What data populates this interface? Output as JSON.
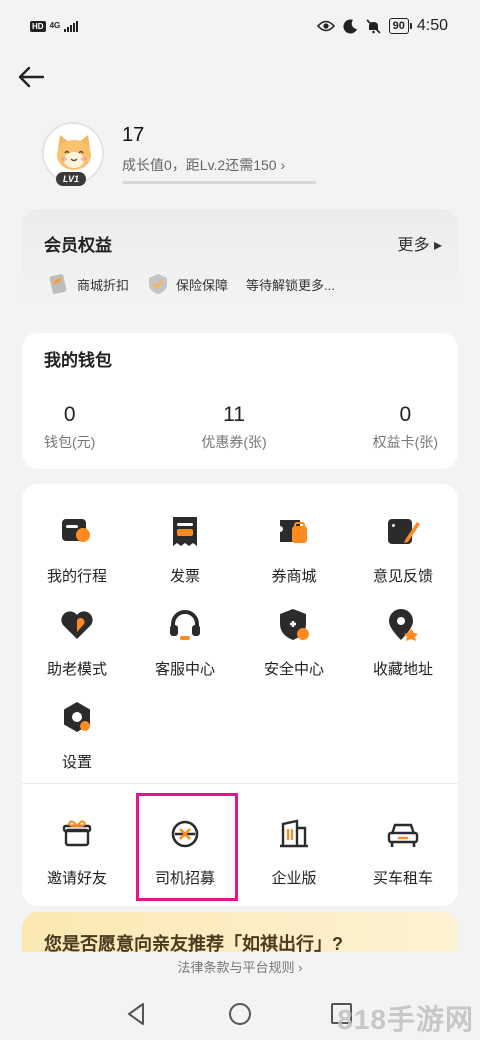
{
  "status_bar": {
    "hd": "HD",
    "network": "4G",
    "battery": "90",
    "time": "4:50"
  },
  "profile": {
    "username": "17",
    "level_badge": "LV1",
    "growth_text": "成长值0，距Lv.2还需150 ›"
  },
  "member": {
    "title": "会员权益",
    "more": "更多 ▸",
    "perks": [
      "商城折扣",
      "保险保障",
      "等待解锁更多..."
    ]
  },
  "wallet": {
    "title": "我的钱包",
    "stats": [
      {
        "value": "0",
        "label": "钱包(元)"
      },
      {
        "value": "11",
        "label": "优惠券(张)"
      },
      {
        "value": "0",
        "label": "权益卡(张)"
      }
    ]
  },
  "services": {
    "items": [
      {
        "label": "我的行程",
        "icon": "trip-icon"
      },
      {
        "label": "发票",
        "icon": "invoice-icon"
      },
      {
        "label": "券商城",
        "icon": "coupon-mall-icon"
      },
      {
        "label": "意见反馈",
        "icon": "feedback-icon"
      },
      {
        "label": "助老模式",
        "icon": "elderly-mode-icon"
      },
      {
        "label": "客服中心",
        "icon": "headset-icon"
      },
      {
        "label": "安全中心",
        "icon": "shield-icon"
      },
      {
        "label": "收藏地址",
        "icon": "location-pin-icon"
      },
      {
        "label": "设置",
        "icon": "settings-icon"
      }
    ],
    "extras": [
      {
        "label": "邀请好友",
        "icon": "gift-icon"
      },
      {
        "label": "司机招募",
        "icon": "steering-wheel-icon"
      },
      {
        "label": "企业版",
        "icon": "building-icon"
      },
      {
        "label": "买车租车",
        "icon": "car-icon"
      }
    ]
  },
  "promo": {
    "text": "您是否愿意向亲友推荐「如祺出行」?"
  },
  "legal": {
    "text": "法律条款与平台规则 ›"
  },
  "watermark": "818手游网",
  "colors": {
    "accent": "#ff8a1f",
    "icon_dark": "#2b2b2b",
    "highlight": "#e8138c"
  }
}
